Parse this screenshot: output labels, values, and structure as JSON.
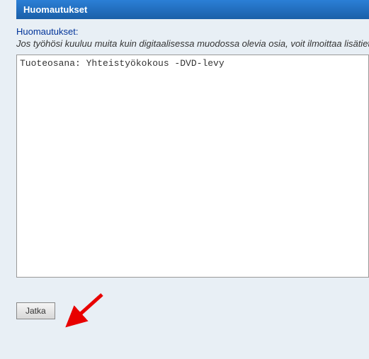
{
  "panel": {
    "header": "Huomautukset"
  },
  "form": {
    "label": "Huomautukset:",
    "help_text": "Jos työhösi kuuluu muita kuin digitaalisessa muodossa olevia osia, voit ilmoittaa lisätietoa",
    "textarea_value": "Tuoteosana: Yhteistyökokous -DVD-levy"
  },
  "actions": {
    "continue_label": "Jatka"
  }
}
